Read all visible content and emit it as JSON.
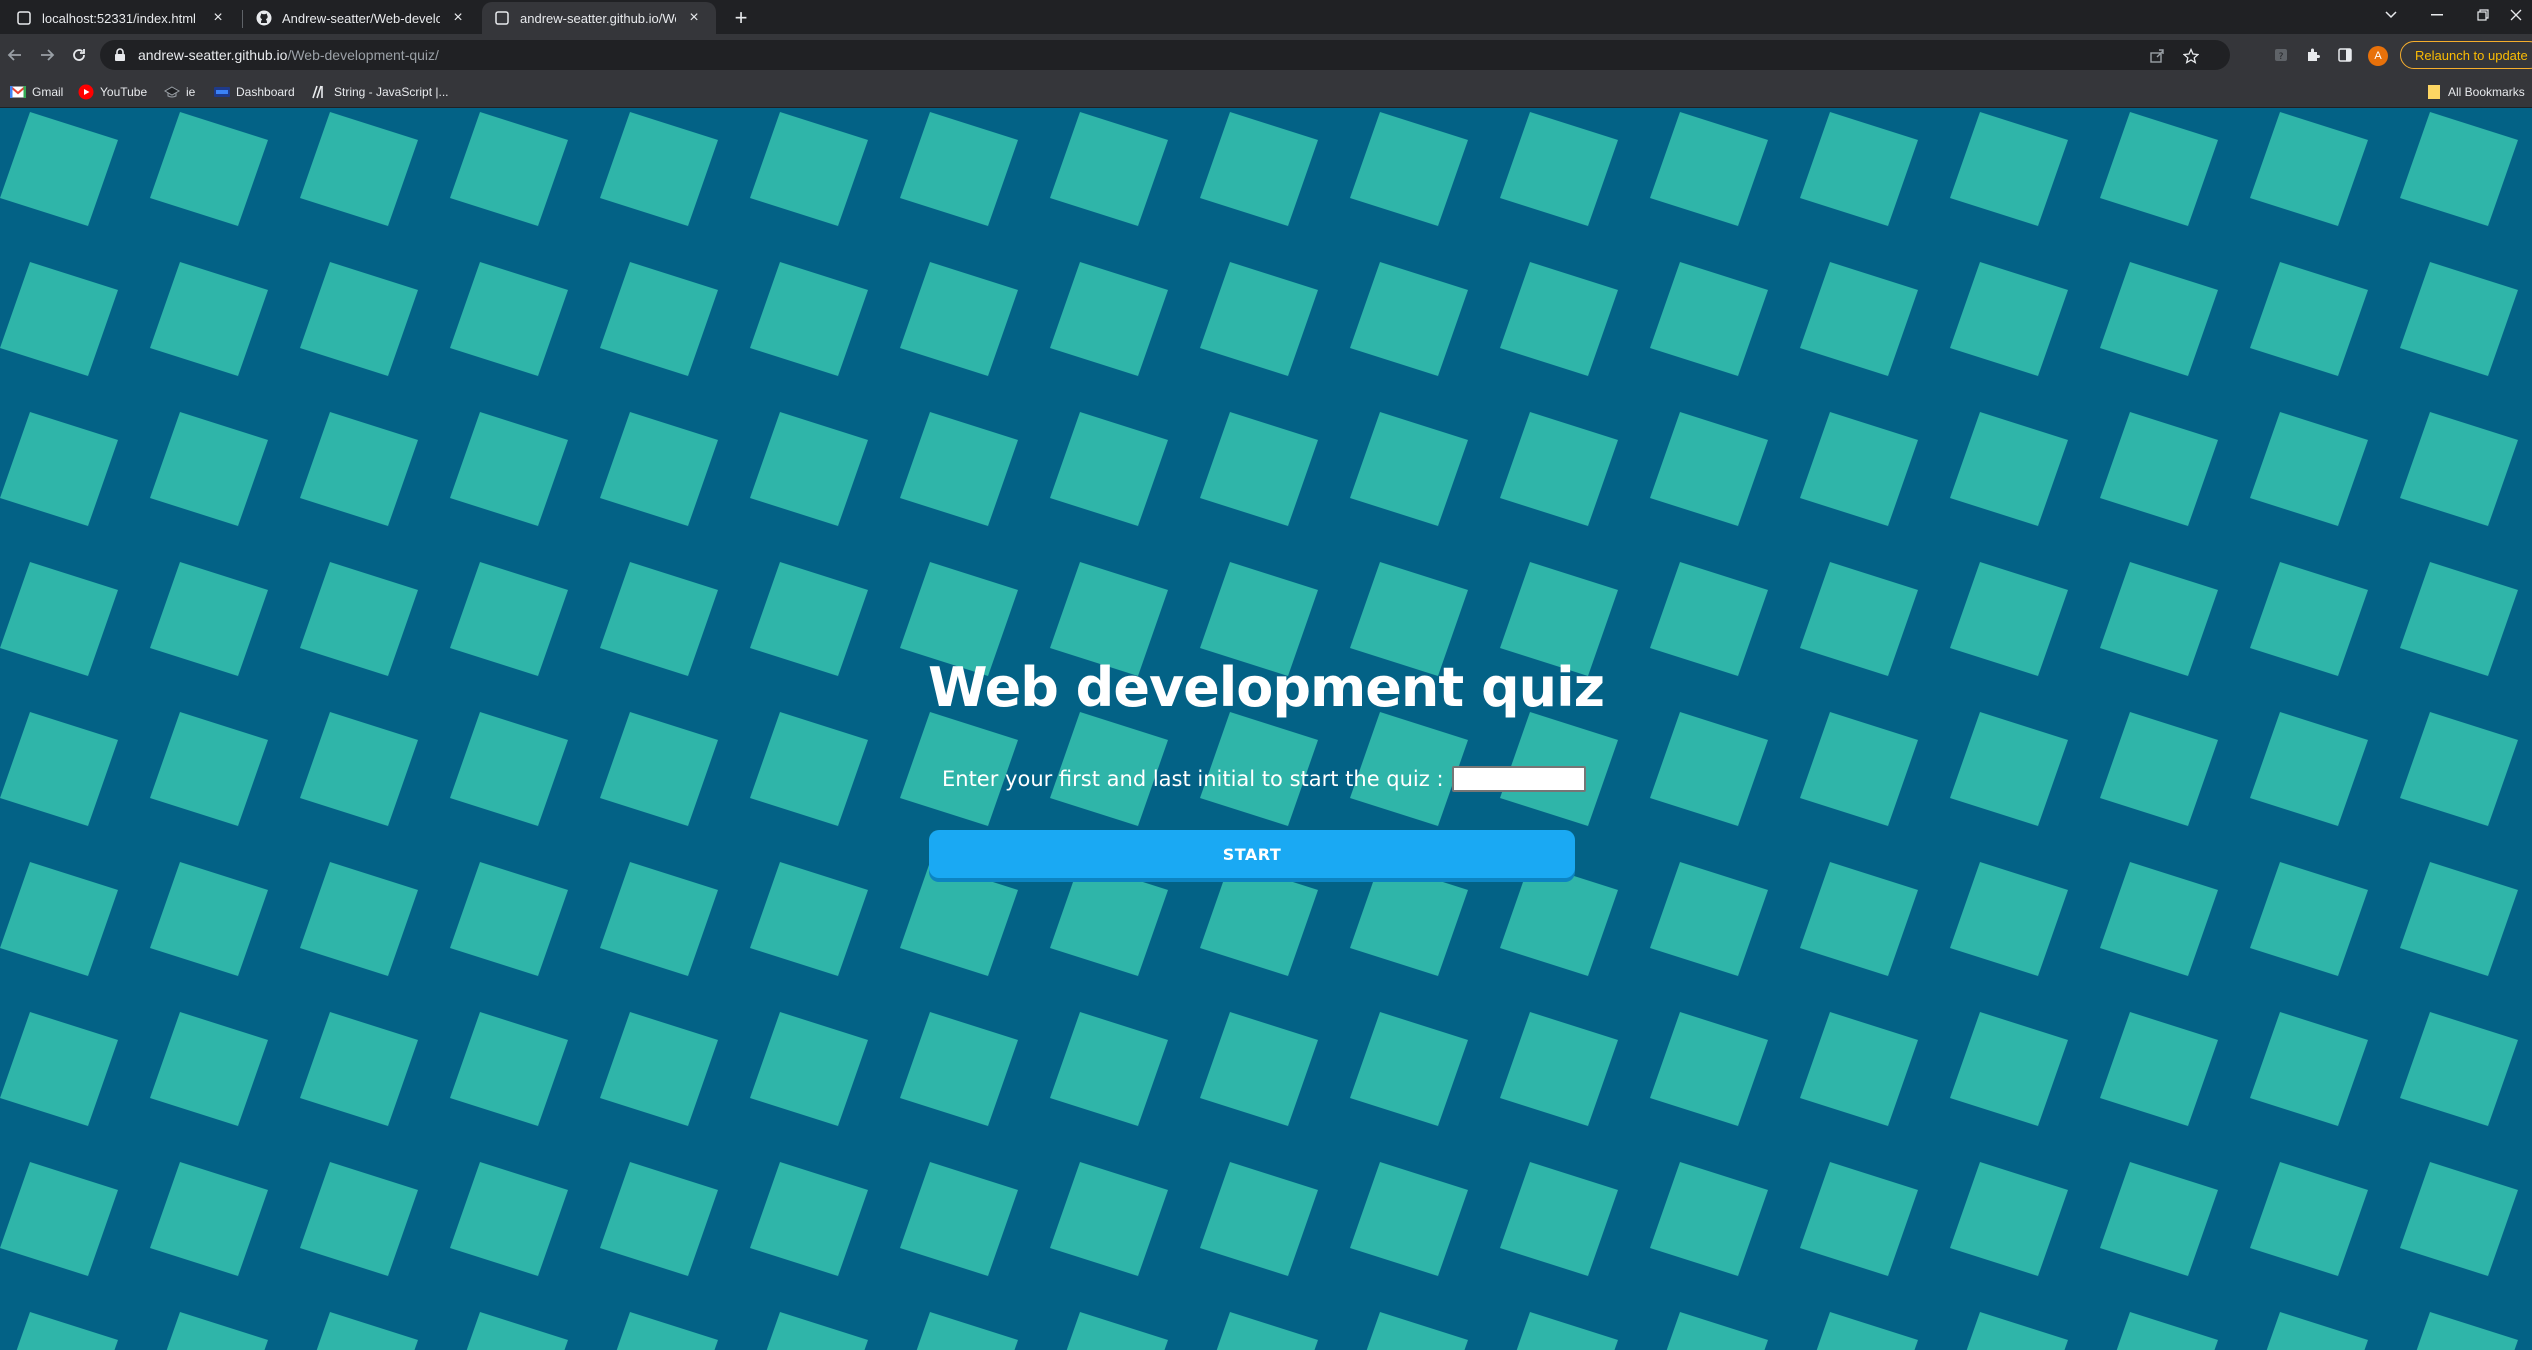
{
  "browser": {
    "tabs": [
      {
        "title": "localhost:52331/index.html",
        "icon": "page-icon",
        "active": false
      },
      {
        "title": "Andrew-seatter/Web-developm",
        "icon": "github-icon",
        "active": false
      },
      {
        "title": "andrew-seatter.github.io/Web-d",
        "icon": "page-icon",
        "active": true
      }
    ],
    "new_tab_label": "+",
    "url_host": "andrew-seatter.github.io",
    "url_path": "/Web-development-quiz/",
    "profile_initial": "A",
    "relaunch_label": "Relaunch to update",
    "bookmarks": [
      {
        "label": "Gmail",
        "icon": "gmail-icon"
      },
      {
        "label": "YouTube",
        "icon": "youtube-icon"
      },
      {
        "label": "ie",
        "icon": "ie-bookmark-icon"
      },
      {
        "label": "Dashboard",
        "icon": "dashboard-icon"
      },
      {
        "label": "String - JavaScript |...",
        "icon": "mdn-icon"
      }
    ],
    "all_bookmarks_label": "All Bookmarks"
  },
  "page": {
    "title": "Web development quiz",
    "initials_label": "Enter your first and last initial to start the quiz :",
    "initials_value": "",
    "start_label": "START"
  },
  "colors": {
    "background": "#036286",
    "tile": "#2fb5a9",
    "button": "#1aa9f3"
  }
}
